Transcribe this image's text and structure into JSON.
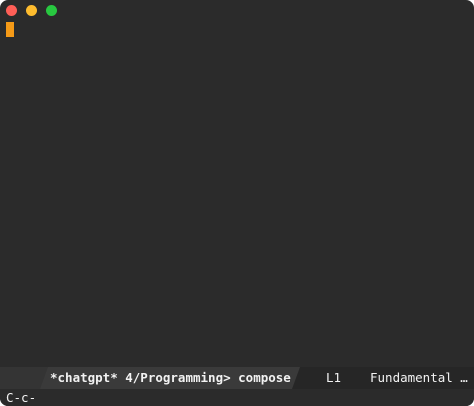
{
  "window": {
    "buttons": [
      "close",
      "minimize",
      "maximize"
    ]
  },
  "editor": {
    "cursor_color": "#f59a17",
    "background": "#2b2b2b"
  },
  "modeline": {
    "buffer": "*chatgpt* 4/Programming> compose",
    "line": "L1",
    "mode": "Fundamental …"
  },
  "minibuffer": {
    "echo": "C-c-"
  }
}
